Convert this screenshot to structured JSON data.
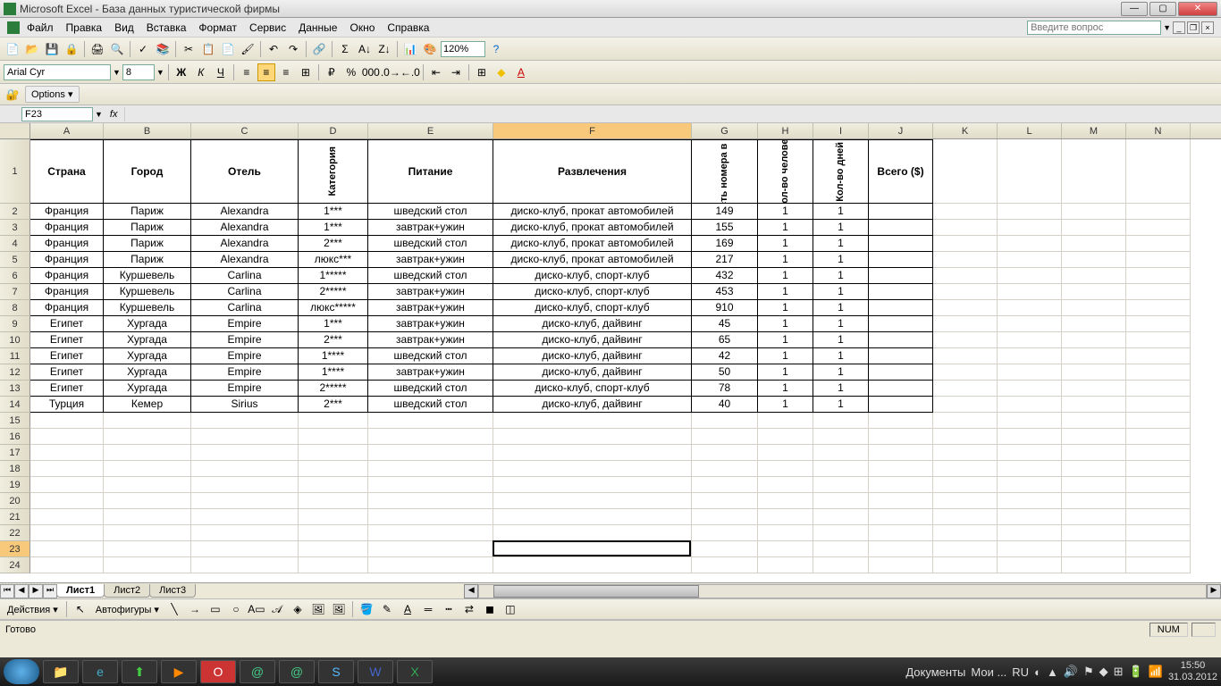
{
  "window": {
    "title": "Microsoft Excel - База данных туристической фирмы",
    "minimize": "—",
    "maximize": "▢",
    "close": "✕"
  },
  "menu": {
    "file": "Файл",
    "edit": "Правка",
    "view": "Вид",
    "insert": "Вставка",
    "format": "Формат",
    "tools": "Сервис",
    "data": "Данные",
    "window": "Окно",
    "help": "Справка",
    "ask_placeholder": "Введите вопрос"
  },
  "toolbar": {
    "zoom": "120%"
  },
  "format": {
    "font_name": "Arial Cyr",
    "font_size": "8"
  },
  "options": {
    "label": "Options"
  },
  "namebox": {
    "ref": "F23",
    "fx": "fx"
  },
  "columns": [
    "A",
    "B",
    "C",
    "D",
    "E",
    "F",
    "G",
    "H",
    "I",
    "J",
    "K",
    "L",
    "M",
    "N"
  ],
  "headers": {
    "A": "Страна",
    "B": "Город",
    "C": "Отель",
    "D": "Категория",
    "E": "Питание",
    "F": "Развлечения",
    "G": "Стоимость номера в сутки ($)",
    "H": "Кол-во человек",
    "I": "Кол-во дней",
    "J": "Всего ($)"
  },
  "rows": [
    {
      "n": 2,
      "A": "Франция",
      "B": "Париж",
      "C": "Alexandra",
      "D": "1***",
      "E": "шведский стол",
      "F": "диско-клуб, прокат автомобилей",
      "G": "149",
      "H": "1",
      "I": "1",
      "J": ""
    },
    {
      "n": 3,
      "A": "Франция",
      "B": "Париж",
      "C": "Alexandra",
      "D": "1***",
      "E": "завтрак+ужин",
      "F": "диско-клуб, прокат автомобилей",
      "G": "155",
      "H": "1",
      "I": "1",
      "J": ""
    },
    {
      "n": 4,
      "A": "Франция",
      "B": "Париж",
      "C": "Alexandra",
      "D": "2***",
      "E": "шведский стол",
      "F": "диско-клуб, прокат автомобилей",
      "G": "169",
      "H": "1",
      "I": "1",
      "J": ""
    },
    {
      "n": 5,
      "A": "Франция",
      "B": "Париж",
      "C": "Alexandra",
      "D": "люкс***",
      "E": "завтрак+ужин",
      "F": "диско-клуб, прокат автомобилей",
      "G": "217",
      "H": "1",
      "I": "1",
      "J": ""
    },
    {
      "n": 6,
      "A": "Франция",
      "B": "Куршевель",
      "C": "Carlina",
      "D": "1*****",
      "E": "шведский стол",
      "F": "диско-клуб, спорт-клуб",
      "G": "432",
      "H": "1",
      "I": "1",
      "J": ""
    },
    {
      "n": 7,
      "A": "Франция",
      "B": "Куршевель",
      "C": "Carlina",
      "D": "2*****",
      "E": "завтрак+ужин",
      "F": "диско-клуб, спорт-клуб",
      "G": "453",
      "H": "1",
      "I": "1",
      "J": ""
    },
    {
      "n": 8,
      "A": "Франция",
      "B": "Куршевель",
      "C": "Carlina",
      "D": "люкс*****",
      "E": "завтрак+ужин",
      "F": "диско-клуб, спорт-клуб",
      "G": "910",
      "H": "1",
      "I": "1",
      "J": ""
    },
    {
      "n": 9,
      "A": "Египет",
      "B": "Хургада",
      "C": "Empire",
      "D": "1***",
      "E": "завтрак+ужин",
      "F": "диско-клуб, дайвинг",
      "G": "45",
      "H": "1",
      "I": "1",
      "J": ""
    },
    {
      "n": 10,
      "A": "Египет",
      "B": "Хургада",
      "C": "Empire",
      "D": "2***",
      "E": "завтрак+ужин",
      "F": "диско-клуб, дайвинг",
      "G": "65",
      "H": "1",
      "I": "1",
      "J": ""
    },
    {
      "n": 11,
      "A": "Египет",
      "B": "Хургада",
      "C": "Empire",
      "D": "1****",
      "E": "шведский стол",
      "F": "диско-клуб, дайвинг",
      "G": "42",
      "H": "1",
      "I": "1",
      "J": ""
    },
    {
      "n": 12,
      "A": "Египет",
      "B": "Хургада",
      "C": "Empire",
      "D": "1****",
      "E": "завтрак+ужин",
      "F": "диско-клуб, дайвинг",
      "G": "50",
      "H": "1",
      "I": "1",
      "J": ""
    },
    {
      "n": 13,
      "A": "Египет",
      "B": "Хургада",
      "C": "Empire",
      "D": "2*****",
      "E": "шведский стол",
      "F": "диско-клуб, спорт-клуб",
      "G": "78",
      "H": "1",
      "I": "1",
      "J": ""
    },
    {
      "n": 14,
      "A": "Турция",
      "B": "Кемер",
      "C": "Sirius",
      "D": "2***",
      "E": "шведский стол",
      "F": "диско-клуб, дайвинг",
      "G": "40",
      "H": "1",
      "I": "1",
      "J": ""
    }
  ],
  "empty_rows": [
    15,
    16,
    17,
    18,
    19,
    20,
    21,
    22,
    23,
    24
  ],
  "sheets": {
    "s1": "Лист1",
    "s2": "Лист2",
    "s3": "Лист3"
  },
  "draw": {
    "actions": "Действия",
    "autoshapes": "Автофигуры"
  },
  "status": {
    "ready": "Готово",
    "num": "NUM"
  },
  "taskbar": {
    "documents": "Документы",
    "my": "Мои ...",
    "lang": "RU",
    "time": "15:50",
    "date": "31.03.2012"
  }
}
